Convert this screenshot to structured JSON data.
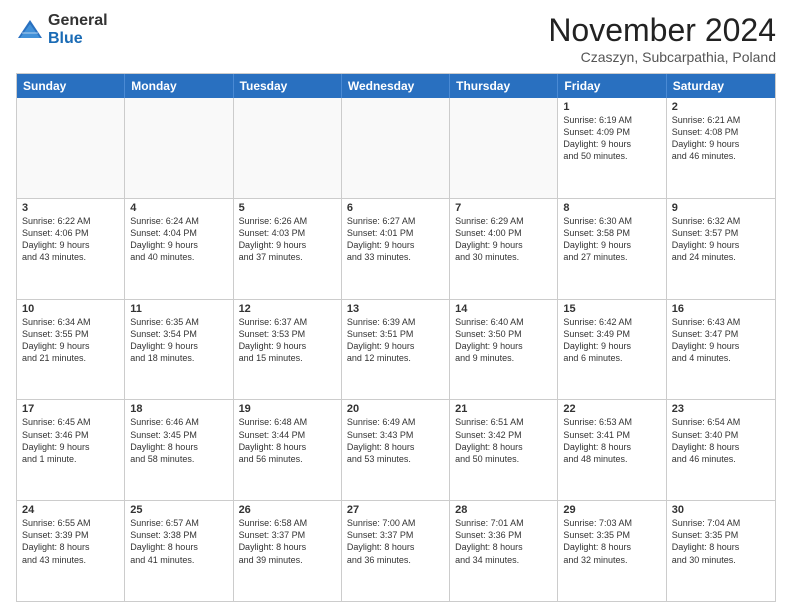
{
  "header": {
    "logo_general": "General",
    "logo_blue": "Blue",
    "month_title": "November 2024",
    "location": "Czaszyn, Subcarpathia, Poland"
  },
  "days_of_week": [
    "Sunday",
    "Monday",
    "Tuesday",
    "Wednesday",
    "Thursday",
    "Friday",
    "Saturday"
  ],
  "rows": [
    [
      {
        "day": "",
        "info": "",
        "empty": true
      },
      {
        "day": "",
        "info": "",
        "empty": true
      },
      {
        "day": "",
        "info": "",
        "empty": true
      },
      {
        "day": "",
        "info": "",
        "empty": true
      },
      {
        "day": "",
        "info": "",
        "empty": true
      },
      {
        "day": "1",
        "info": "Sunrise: 6:19 AM\nSunset: 4:09 PM\nDaylight: 9 hours\nand 50 minutes.",
        "empty": false
      },
      {
        "day": "2",
        "info": "Sunrise: 6:21 AM\nSunset: 4:08 PM\nDaylight: 9 hours\nand 46 minutes.",
        "empty": false
      }
    ],
    [
      {
        "day": "3",
        "info": "Sunrise: 6:22 AM\nSunset: 4:06 PM\nDaylight: 9 hours\nand 43 minutes.",
        "empty": false
      },
      {
        "day": "4",
        "info": "Sunrise: 6:24 AM\nSunset: 4:04 PM\nDaylight: 9 hours\nand 40 minutes.",
        "empty": false
      },
      {
        "day": "5",
        "info": "Sunrise: 6:26 AM\nSunset: 4:03 PM\nDaylight: 9 hours\nand 37 minutes.",
        "empty": false
      },
      {
        "day": "6",
        "info": "Sunrise: 6:27 AM\nSunset: 4:01 PM\nDaylight: 9 hours\nand 33 minutes.",
        "empty": false
      },
      {
        "day": "7",
        "info": "Sunrise: 6:29 AM\nSunset: 4:00 PM\nDaylight: 9 hours\nand 30 minutes.",
        "empty": false
      },
      {
        "day": "8",
        "info": "Sunrise: 6:30 AM\nSunset: 3:58 PM\nDaylight: 9 hours\nand 27 minutes.",
        "empty": false
      },
      {
        "day": "9",
        "info": "Sunrise: 6:32 AM\nSunset: 3:57 PM\nDaylight: 9 hours\nand 24 minutes.",
        "empty": false
      }
    ],
    [
      {
        "day": "10",
        "info": "Sunrise: 6:34 AM\nSunset: 3:55 PM\nDaylight: 9 hours\nand 21 minutes.",
        "empty": false
      },
      {
        "day": "11",
        "info": "Sunrise: 6:35 AM\nSunset: 3:54 PM\nDaylight: 9 hours\nand 18 minutes.",
        "empty": false
      },
      {
        "day": "12",
        "info": "Sunrise: 6:37 AM\nSunset: 3:53 PM\nDaylight: 9 hours\nand 15 minutes.",
        "empty": false
      },
      {
        "day": "13",
        "info": "Sunrise: 6:39 AM\nSunset: 3:51 PM\nDaylight: 9 hours\nand 12 minutes.",
        "empty": false
      },
      {
        "day": "14",
        "info": "Sunrise: 6:40 AM\nSunset: 3:50 PM\nDaylight: 9 hours\nand 9 minutes.",
        "empty": false
      },
      {
        "day": "15",
        "info": "Sunrise: 6:42 AM\nSunset: 3:49 PM\nDaylight: 9 hours\nand 6 minutes.",
        "empty": false
      },
      {
        "day": "16",
        "info": "Sunrise: 6:43 AM\nSunset: 3:47 PM\nDaylight: 9 hours\nand 4 minutes.",
        "empty": false
      }
    ],
    [
      {
        "day": "17",
        "info": "Sunrise: 6:45 AM\nSunset: 3:46 PM\nDaylight: 9 hours\nand 1 minute.",
        "empty": false
      },
      {
        "day": "18",
        "info": "Sunrise: 6:46 AM\nSunset: 3:45 PM\nDaylight: 8 hours\nand 58 minutes.",
        "empty": false
      },
      {
        "day": "19",
        "info": "Sunrise: 6:48 AM\nSunset: 3:44 PM\nDaylight: 8 hours\nand 56 minutes.",
        "empty": false
      },
      {
        "day": "20",
        "info": "Sunrise: 6:49 AM\nSunset: 3:43 PM\nDaylight: 8 hours\nand 53 minutes.",
        "empty": false
      },
      {
        "day": "21",
        "info": "Sunrise: 6:51 AM\nSunset: 3:42 PM\nDaylight: 8 hours\nand 50 minutes.",
        "empty": false
      },
      {
        "day": "22",
        "info": "Sunrise: 6:53 AM\nSunset: 3:41 PM\nDaylight: 8 hours\nand 48 minutes.",
        "empty": false
      },
      {
        "day": "23",
        "info": "Sunrise: 6:54 AM\nSunset: 3:40 PM\nDaylight: 8 hours\nand 46 minutes.",
        "empty": false
      }
    ],
    [
      {
        "day": "24",
        "info": "Sunrise: 6:55 AM\nSunset: 3:39 PM\nDaylight: 8 hours\nand 43 minutes.",
        "empty": false
      },
      {
        "day": "25",
        "info": "Sunrise: 6:57 AM\nSunset: 3:38 PM\nDaylight: 8 hours\nand 41 minutes.",
        "empty": false
      },
      {
        "day": "26",
        "info": "Sunrise: 6:58 AM\nSunset: 3:37 PM\nDaylight: 8 hours\nand 39 minutes.",
        "empty": false
      },
      {
        "day": "27",
        "info": "Sunrise: 7:00 AM\nSunset: 3:37 PM\nDaylight: 8 hours\nand 36 minutes.",
        "empty": false
      },
      {
        "day": "28",
        "info": "Sunrise: 7:01 AM\nSunset: 3:36 PM\nDaylight: 8 hours\nand 34 minutes.",
        "empty": false
      },
      {
        "day": "29",
        "info": "Sunrise: 7:03 AM\nSunset: 3:35 PM\nDaylight: 8 hours\nand 32 minutes.",
        "empty": false
      },
      {
        "day": "30",
        "info": "Sunrise: 7:04 AM\nSunset: 3:35 PM\nDaylight: 8 hours\nand 30 minutes.",
        "empty": false
      }
    ]
  ]
}
